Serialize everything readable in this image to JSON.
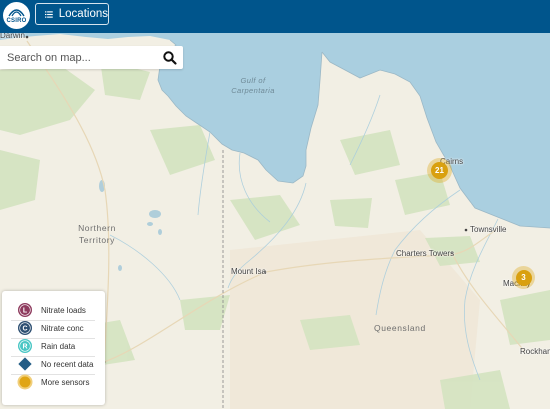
{
  "header": {
    "logo_text": "CSIRO",
    "locations_label": "Locations"
  },
  "search": {
    "placeholder": "Search on map..."
  },
  "map": {
    "places": [
      {
        "name": "Darwin"
      },
      {
        "name": "Mount Isa"
      },
      {
        "name": "Charters Towers"
      },
      {
        "name": "Townsville"
      },
      {
        "name": "Cairns"
      },
      {
        "name": "Mackay"
      },
      {
        "name": "Rockham"
      }
    ],
    "regions": [
      {
        "name": "Northern Territory"
      },
      {
        "name": "Queensland"
      }
    ],
    "water_label": "Gulf of Carpentaria",
    "clusters": [
      {
        "count": "21"
      },
      {
        "count": "3"
      }
    ]
  },
  "legend": {
    "items": [
      {
        "letter": "L",
        "label": "Nitrate loads",
        "color": "#8e3b5e"
      },
      {
        "letter": "C",
        "label": "Nitrate conc",
        "color": "#2d4f72"
      },
      {
        "letter": "R",
        "label": "Rain data",
        "color": "#48c6c4"
      },
      {
        "letter": "",
        "label": "No recent data",
        "color": "#245d86"
      },
      {
        "letter": "",
        "label": "More sensors",
        "color": "#e0a514"
      }
    ]
  },
  "colors": {
    "header": "#00558c",
    "sea": "#aacfe0",
    "land": "#f2efe4",
    "vegetation": "#d3e3c0",
    "cluster": "#d9a00f"
  }
}
